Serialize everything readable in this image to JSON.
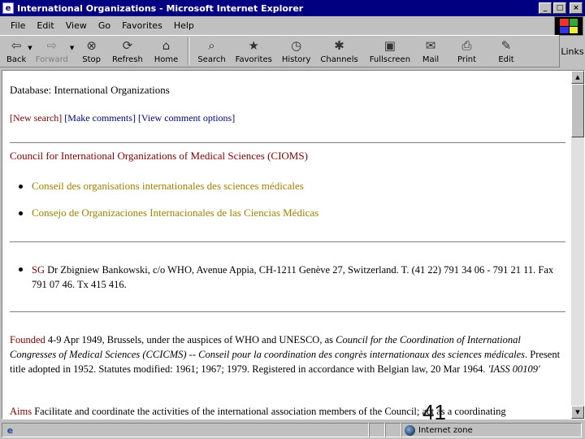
{
  "window": {
    "title": "International Organizations - Microsoft Internet Explorer",
    "controls": [
      "_",
      "□",
      "×"
    ]
  },
  "menu": [
    "File",
    "Edit",
    "View",
    "Go",
    "Favorites",
    "Help"
  ],
  "toolbar": {
    "back": "Back",
    "forward": "Forward",
    "stop": "Stop",
    "refresh": "Refresh",
    "home": "Home",
    "search": "Search",
    "favorites": "Favorites",
    "history": "History",
    "channels": "Channels",
    "fullscreen": "Fullscreen",
    "mail": "Mail",
    "print": "Print",
    "edit": "Edit",
    "links": "Links"
  },
  "page": {
    "heading": "Database: International Organizations",
    "nav": {
      "new_search": "[New search]",
      "make_comments": "[Make comments]",
      "view_comment_options": "[View comment options]"
    },
    "org_name": "Council for International Organizations of Medical Sciences (CIOMS)",
    "alt_names": [
      "Conseil des organisations internationales des sciences médicales",
      "Consejo de Organizaciones Internacionales de las Ciencias Médicas"
    ],
    "sg_label": "SG",
    "sg_text": " Dr Zbigniew Bankowski, c/o WHO, Avenue Appia, CH-1211 Genève 27, Switzerland. T. (41 22) 791 34 06 - 791 21 11. Fax 791 07 46. Tx 415 416.",
    "founded_label": "Founded",
    "founded_text_1": " 4-9 Apr 1949, Brussels, under the auspices of WHO and UNESCO, as ",
    "founded_italic": "Council for the Coordination of International Congresses of Medical Sciences (CCICMS) -- Conseil pour la coordination des congrès internationaux des sciences médicales",
    "founded_text_2": ". Present title adopted in 1952. Statutes modified: 1961; 1967; 1979. Registered in accordance with Belgian law, 20 Mar 1964. ",
    "founded_code": "'IASS 00109'",
    "aims_label": "Aims",
    "aims_text": " Facilitate and coordinate the activities of the international association members of the Council; act as a coordinating"
  },
  "slide_number": "41",
  "status": {
    "zone": "Internet zone"
  }
}
